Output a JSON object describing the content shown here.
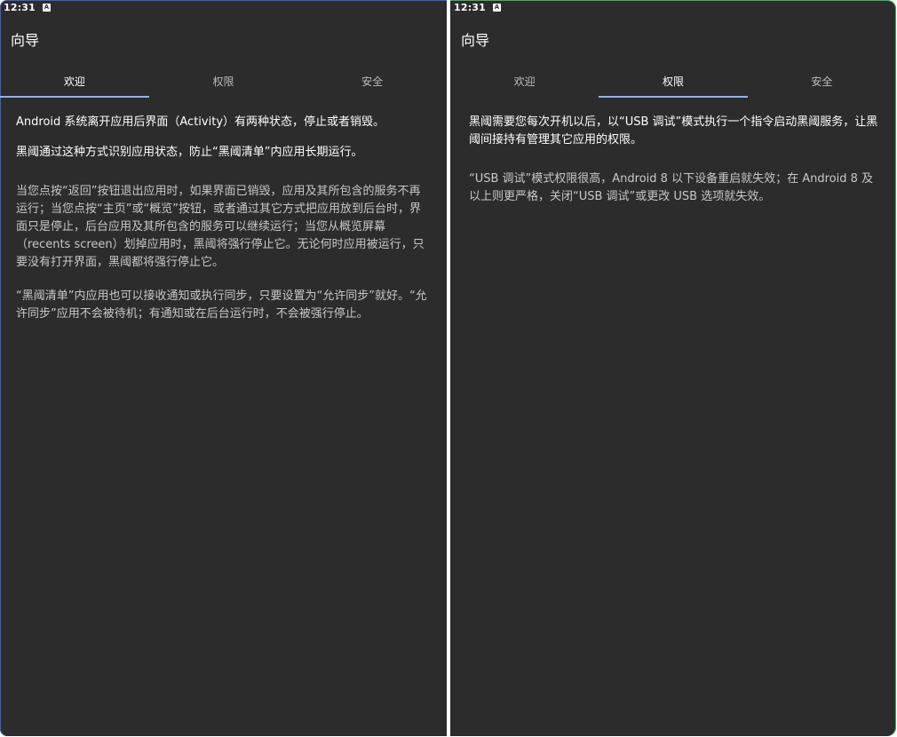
{
  "status_bar": {
    "time": "12:31",
    "notification_glyph": "A"
  },
  "app_bar": {
    "title": "向导"
  },
  "tabs": [
    {
      "label": "欢迎"
    },
    {
      "label": "权限"
    },
    {
      "label": "安全"
    }
  ],
  "screens": [
    {
      "active_tab": "欢迎",
      "paragraphs": [
        "Android 系统离开应用后界面（Activity）有两种状态，停止或者销毁。",
        "黑阈通过这种方式识别应用状态，防止“黑阈清单”内应用长期运行。",
        "当您点按“返回”按钮退出应用时，如果界面已销毁，应用及其所包含的服务不再运行；当您点按“主页”或“概览”按钮，或者通过其它方式把应用放到后台时，界面只是停止，后台应用及其所包含的服务可以继续运行；当您从概览屏幕（recents screen）划掉应用时，黑阈将强行停止它。无论何时应用被运行，只要没有打开界面，黑阈都将强行停止它。",
        "“黑阈清单”内应用也可以接收通知或执行同步，只要设置为“允许同步”就好。“允许同步”应用不会被待机；有通知或在后台运行时，不会被强行停止。"
      ]
    },
    {
      "active_tab": "权限",
      "paragraphs": [
        "黑阈需要您每次开机以后，以“USB 调试”模式执行一个指令启动黑阈服务，让黑阈间接持有管理其它应用的权限。",
        "“USB 调试”模式权限很高，Android 8 以下设备重启就失效；在 Android 8 及以上则更严格，关闭“USB 调试”或更改 USB 选项就失效。"
      ]
    }
  ],
  "colors": {
    "background": "#2c2c2c",
    "tab_indicator": "#8ab4f8",
    "primary_text": "#ffffff",
    "secondary_text": "#c8c8c8"
  }
}
